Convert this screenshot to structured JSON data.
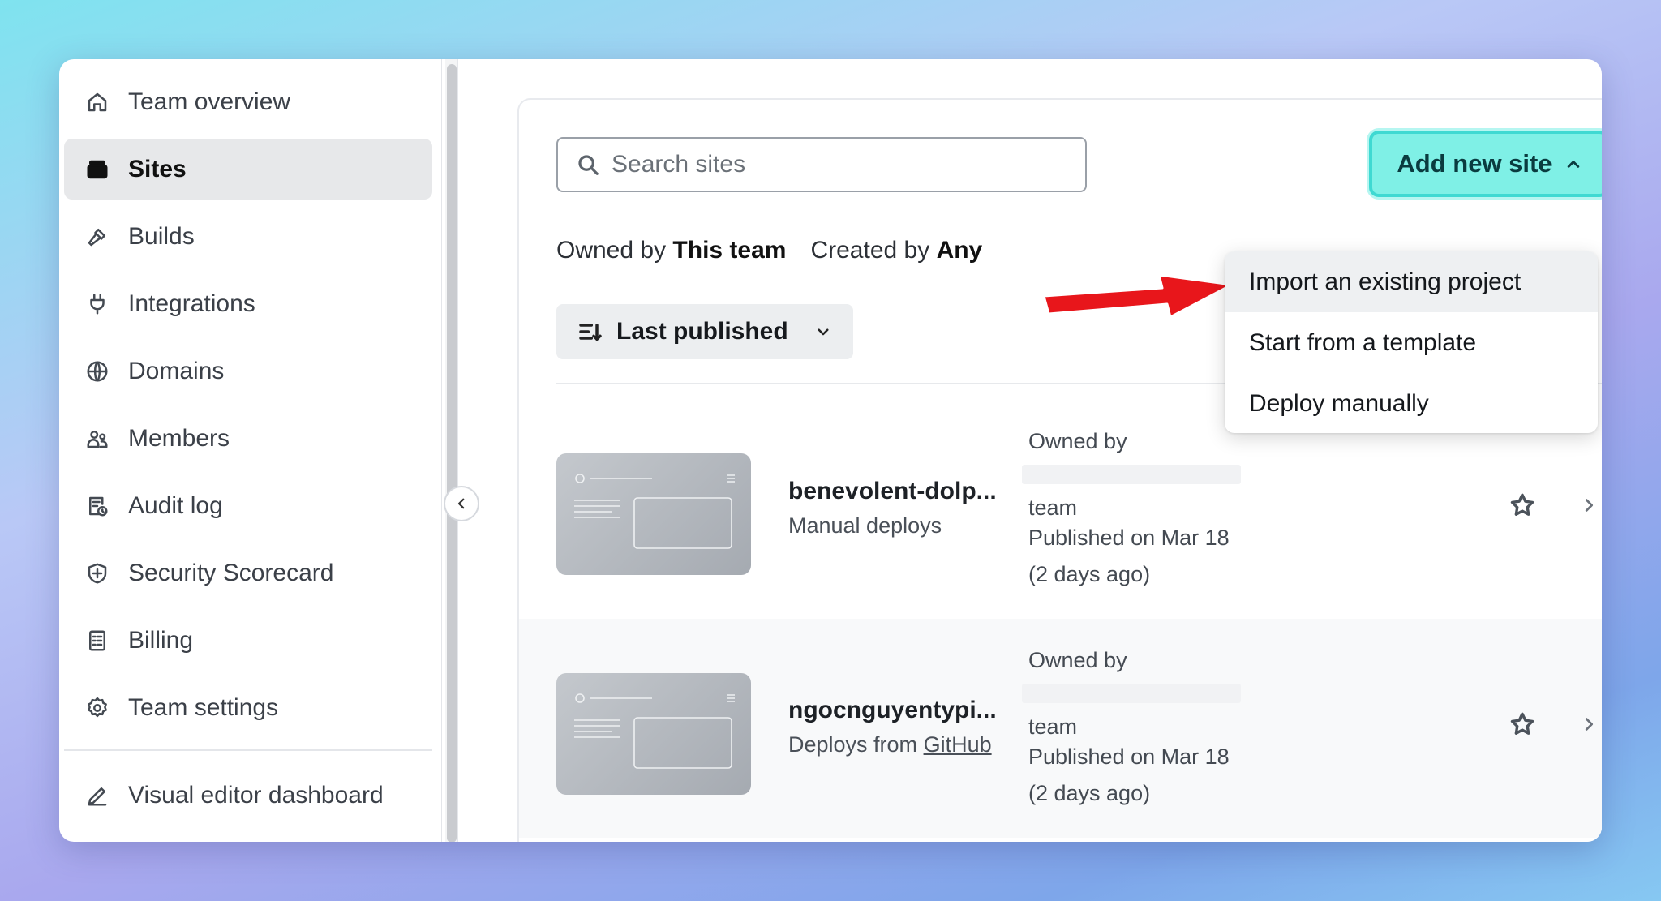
{
  "sidebar": {
    "items": [
      {
        "label": "Team overview",
        "icon": "home-icon",
        "active": false
      },
      {
        "label": "Sites",
        "icon": "stack-icon",
        "active": true
      },
      {
        "label": "Builds",
        "icon": "hammer-icon",
        "active": false
      },
      {
        "label": "Integrations",
        "icon": "plug-icon",
        "active": false
      },
      {
        "label": "Domains",
        "icon": "globe-icon",
        "active": false
      },
      {
        "label": "Members",
        "icon": "members-icon",
        "active": false
      },
      {
        "label": "Audit log",
        "icon": "audit-icon",
        "active": false
      },
      {
        "label": "Security Scorecard",
        "icon": "shield-icon",
        "active": false
      },
      {
        "label": "Billing",
        "icon": "receipt-icon",
        "active": false
      },
      {
        "label": "Team settings",
        "icon": "gear-icon",
        "active": false
      }
    ],
    "footer_item": {
      "label": "Visual editor dashboard",
      "icon": "pencil-icon"
    }
  },
  "search": {
    "placeholder": "Search sites"
  },
  "add_button": {
    "label": "Add new site"
  },
  "filters": {
    "owned_prefix": "Owned by",
    "owned_value": "This team",
    "created_prefix": "Created by",
    "created_value": "Any"
  },
  "sort": {
    "label": "Last published"
  },
  "dropdown": {
    "items": [
      "Import an existing project",
      "Start from a template",
      "Deploy manually"
    ]
  },
  "sites": [
    {
      "name": "benevolent-dolp...",
      "deploy_text": "Manual deploys",
      "deploy_link": "",
      "owned_label": "Owned by",
      "owner_suffix": "team",
      "published": "Published on Mar 18",
      "relative": "(2 days ago)"
    },
    {
      "name": "ngocnguyentypi...",
      "deploy_text": "Deploys from ",
      "deploy_link": "GitHub",
      "owned_label": "Owned by",
      "owner_suffix": "team",
      "published": "Published on Mar 18",
      "relative": "(2 days ago)"
    }
  ],
  "colors": {
    "accent": "#7ff0e6",
    "accent_border": "#3fd9d2",
    "annotation_arrow": "#e8161b"
  }
}
